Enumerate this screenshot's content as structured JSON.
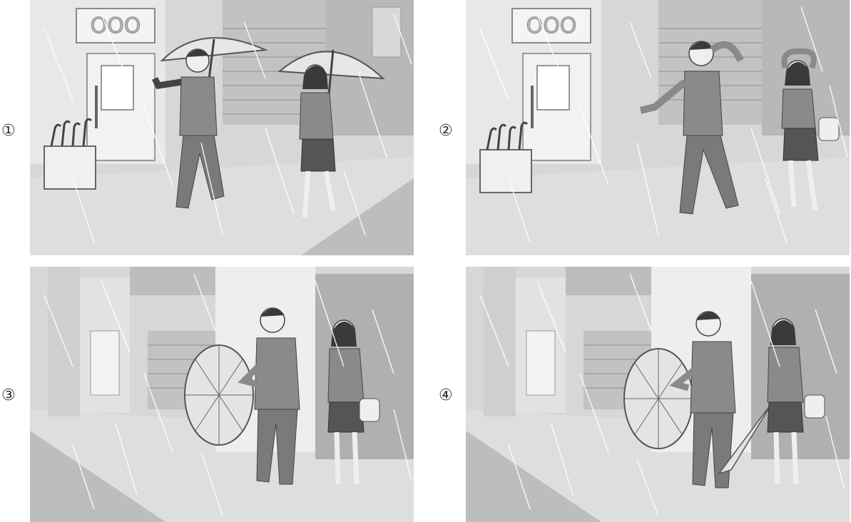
{
  "panels": [
    {
      "number": "①",
      "sign_text": "OOO",
      "scene": "walking-with-umbrellas"
    },
    {
      "number": "②",
      "sign_text": "OOO",
      "scene": "caught-in-rain"
    },
    {
      "number": "③",
      "sign_text": "",
      "scene": "offering-open-umbrella"
    },
    {
      "number": "④",
      "sign_text": "",
      "scene": "sharing-umbrellas"
    }
  ],
  "colors": {
    "background": "#ffffff",
    "building_light": "#ececec",
    "building_mid": "#c9c9c9",
    "building_dark": "#9a9a9a",
    "ground": "#dcdcdc",
    "suit": "#8a8a8a",
    "skirt": "#555555",
    "skin": "#ededed",
    "hair": "#3a3a3a",
    "rain": "#ffffff"
  },
  "icons": {
    "umbrella": "umbrella-icon",
    "umbrella_stand": "umbrella-stand-icon",
    "rain": "rain-icon"
  }
}
